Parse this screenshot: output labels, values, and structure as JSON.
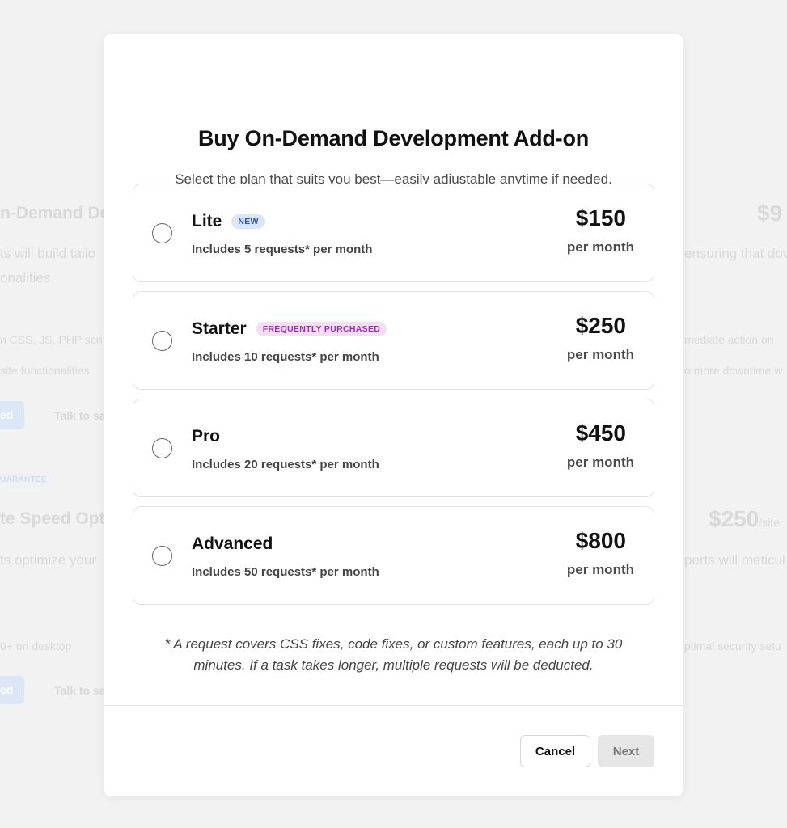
{
  "background": {
    "heading_1": "n-Demand Dev",
    "line_1a": "ts will build tailo",
    "line_1b": "onalities.",
    "small_1a": "n CSS, JS, PHP scri",
    "small_1b": "site functionalities",
    "cta_1": "ed",
    "link_1": "Talk to sa",
    "badge": "UARANTEE",
    "heading_2": "te Speed Opti",
    "line_2a": "ts optimize your",
    "small_2a": "0+ on desktop",
    "cta_2": "ed",
    "link_2": "Talk to sa",
    "right_price_1": "$9",
    "right_line_1": "ensuring that dov",
    "right_small_1a": "mediate action on",
    "right_small_1b": "o more downtime w",
    "right_price_2": "$250",
    "right_price_2_unit": "/site",
    "right_line_2": "perts will meticul",
    "right_small_2": "ptimal security setu"
  },
  "modal": {
    "title": "Buy On-Demand Development Add-on",
    "subtitle": "Select the plan that suits you best—easily adjustable anytime if needed.",
    "plans": [
      {
        "name": "Lite",
        "badge": "NEW",
        "description": "Includes 5 requests* per month",
        "price": "$150",
        "period": "per month"
      },
      {
        "name": "Starter",
        "badge": "FREQUENTLY PURCHASED",
        "description": "Includes 10 requests* per month",
        "price": "$250",
        "period": "per month"
      },
      {
        "name": "Pro",
        "badge": "",
        "description": "Includes 20 requests* per month",
        "price": "$450",
        "period": "per month"
      },
      {
        "name": "Advanced",
        "badge": "",
        "description": "Includes 50 requests* per month",
        "price": "$800",
        "period": "per month"
      }
    ],
    "footnote": "* A request covers CSS fixes, code fixes, or custom features, each up to 30 minutes. If a task takes longer, multiple requests will be deducted.",
    "cancel_label": "Cancel",
    "next_label": "Next"
  },
  "colors": {
    "badge_new_bg": "#dce6fa",
    "badge_new_text": "#3456a8",
    "badge_freq_bg": "#f3def6",
    "badge_freq_text": "#9c2fb5",
    "next_disabled_bg": "#e6e6e6"
  }
}
